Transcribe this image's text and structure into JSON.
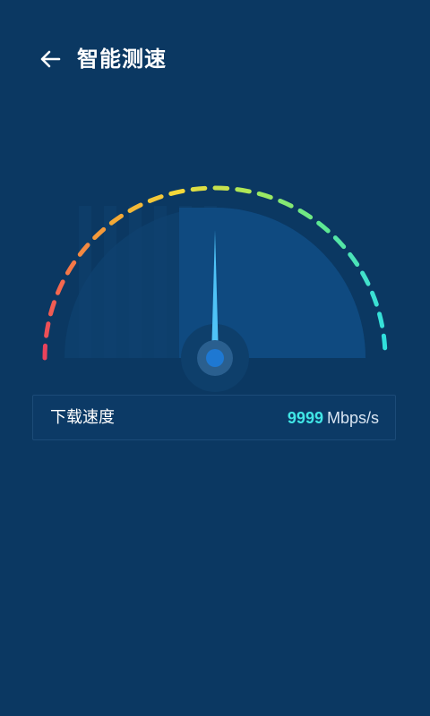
{
  "header": {
    "title": "智能测速",
    "back_icon": "arrow-left-icon"
  },
  "gauge": {
    "needle_level": 0.5,
    "fill_fraction": 0.5,
    "track_colors": [
      "#e9405d",
      "#f46a4e",
      "#f3a336",
      "#f4d83a",
      "#a6e85a",
      "#5ee891",
      "#3fe0d0",
      "#2cdfe0"
    ],
    "needle_color": "#4fc3f7",
    "hub_color": "#1e78d2",
    "fill_color": "#0f4a80"
  },
  "result": {
    "label": "下载速度",
    "value": "9999",
    "unit": "Mbps/s"
  }
}
